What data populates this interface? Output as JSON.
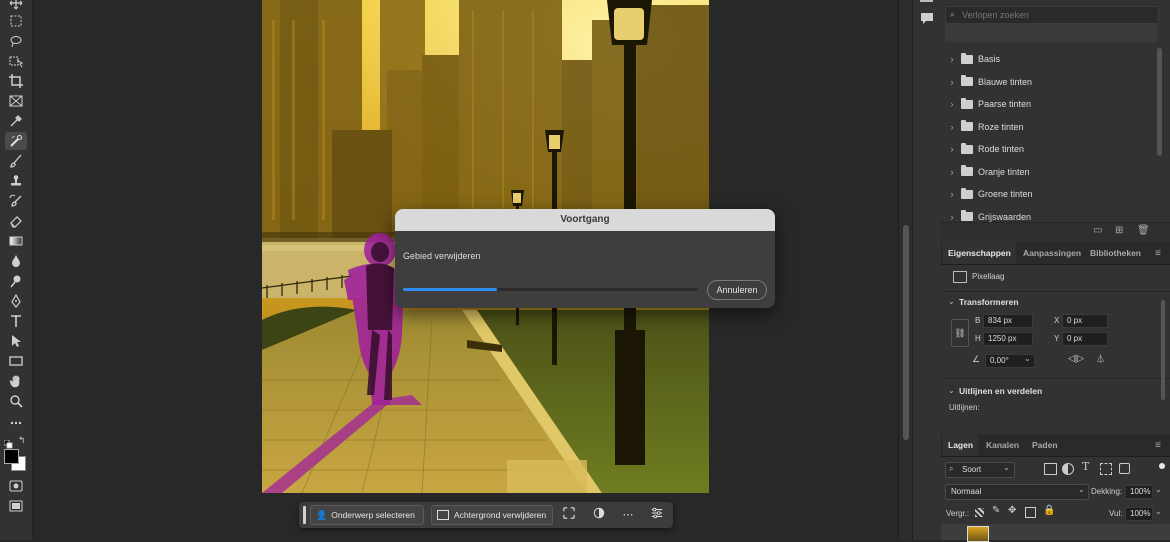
{
  "colors": {
    "accent": "#2e8ef0",
    "selection_overlay": "#a0209c"
  },
  "toolbar": {
    "tools": [
      "move-icon",
      "marquee-icon",
      "lasso-icon",
      "object-select-icon",
      "crop-icon",
      "frame-icon",
      "eyedropper-icon",
      "remove-tool-icon",
      "brush-icon",
      "stamp-icon",
      "history-brush-icon",
      "eraser-icon",
      "gradient-icon",
      "blur-icon",
      "dodge-icon",
      "pen-icon",
      "type-icon",
      "path-select-icon",
      "rectangle-icon",
      "hand-icon",
      "zoom-icon",
      "more-tools-icon"
    ],
    "active_tool": "remove-tool-icon"
  },
  "gradients_panel": {
    "search_placeholder": "Verlopen zoeken",
    "folders": [
      "Basis",
      "Blauwe tinten",
      "Paarse tinten",
      "Roze tinten",
      "Rode tinten",
      "Oranje tinten",
      "Groene tinten",
      "Grijswaarden"
    ]
  },
  "properties_panel": {
    "tabs": [
      "Eigenschappen",
      "Aanpassingen",
      "Bibliotheken"
    ],
    "layer_type": "Pixellaag",
    "transform_title": "Transformeren",
    "w_label": "B",
    "w_value": "834 px",
    "h_label": "H",
    "h_value": "1250 px",
    "x_label": "X",
    "x_value": "0 px",
    "y_label": "Y",
    "y_value": "0 px",
    "angle_value": "0,00°",
    "align_title": "Uitlijnen en verdelen",
    "align_label": "Uitlijnen:"
  },
  "layers_panel": {
    "tabs": [
      "Lagen",
      "Kanalen",
      "Paden"
    ],
    "filter_label": "Soort",
    "blend_mode": "Normaal",
    "opacity_label": "Dekking:",
    "opacity_value": "100%",
    "lock_label": "Vergr.:",
    "fill_label": "Vul:",
    "fill_value": "100%"
  },
  "dialog": {
    "title": "Voortgang",
    "message": "Gebied verwijderen",
    "progress": 0.32,
    "cancel_label": "Annuleren"
  },
  "taskbar": {
    "select_subject_label": "Onderwerp selecteren",
    "remove_background_label": "Achtergrond verwijderen"
  }
}
